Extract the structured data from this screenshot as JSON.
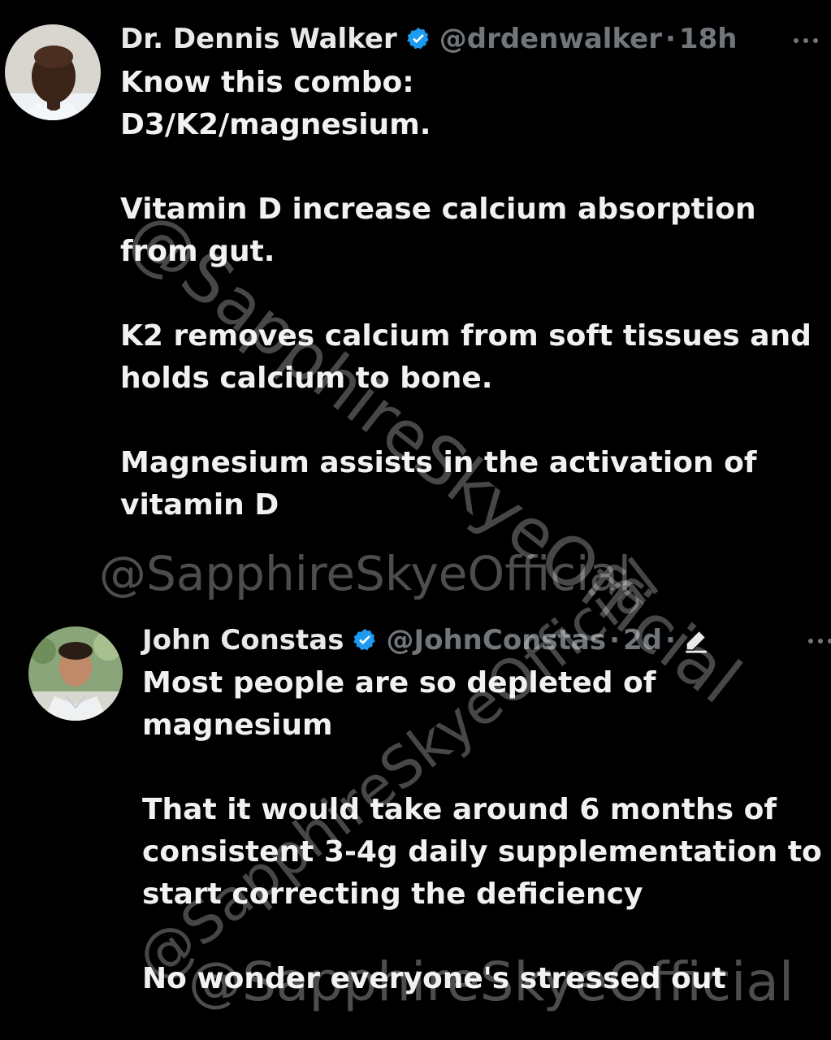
{
  "posts": [
    {
      "author": {
        "name": "Dr. Dennis Walker",
        "handle": "@drdenwalker",
        "time": "18h",
        "separator": "·"
      },
      "paragraphs": [
        "Know this combo:\nD3/K2/magnesium.",
        "Vitamin D increase calcium absorption from gut.",
        "K2 removes calcium from soft tissues and holds calcium to bone.",
        "Magnesium assists in the activation of vitamin D"
      ]
    },
    {
      "author": {
        "name": "John Constas",
        "handle": "@JohnConstas",
        "time": "2d",
        "separator": "·"
      },
      "paragraphs": [
        "Most people are so depleted of magnesium",
        "That it would take around 6 months of consistent 3-4g daily supplementation to start correcting the deficiency",
        "No wonder everyone's stressed out"
      ]
    }
  ],
  "watermarks": [
    "@SapphireSkyeOfficial",
    "@SapphireSkyeOfficial",
    "@SapphireSkyeOfficial",
    "@SapphireSkyeOfficial"
  ],
  "icons": {
    "verified": "verified-badge-icon",
    "more": "more-options-icon",
    "edited": "edit-pencil-icon"
  },
  "colors": {
    "background": "#000000",
    "text": "#e7e9ea",
    "muted": "#71767b",
    "verified": "#1d9bf0"
  }
}
